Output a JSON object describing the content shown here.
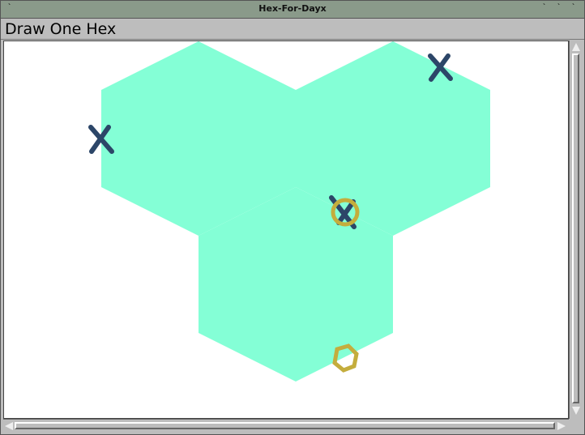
{
  "window": {
    "title": "Hex-For-Dayx",
    "title_buttons": [
      "`",
      "`",
      "`",
      "`"
    ]
  },
  "menu": {
    "label": "Draw One Hex"
  },
  "board": {
    "hex_color": "#84ffd6",
    "x_mark_color": "#2c4668",
    "o_mark_color": "#c4ad3d",
    "marks": [
      "x-mark",
      "x-mark",
      "x-mark",
      "o-mark",
      "o-mark"
    ]
  }
}
